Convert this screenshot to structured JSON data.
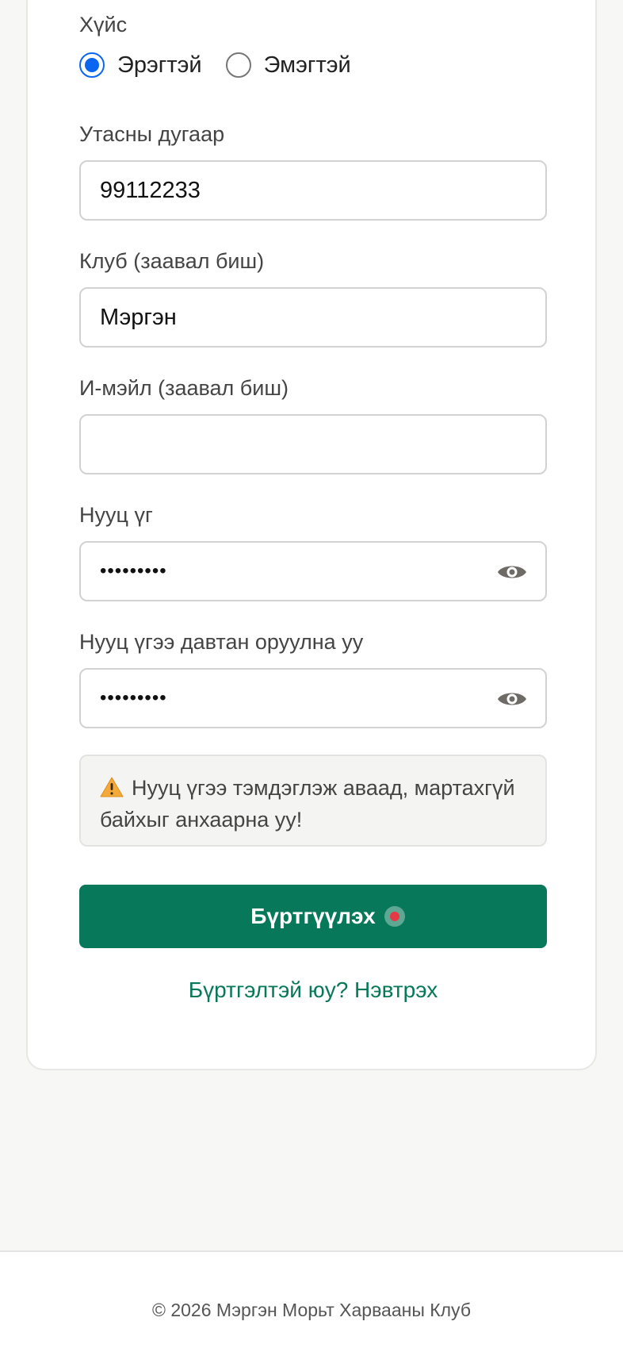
{
  "form": {
    "gender_label": "Хүйс",
    "gender_options": [
      {
        "label": "Эрэгтэй",
        "selected": true
      },
      {
        "label": "Эмэгтэй",
        "selected": false
      }
    ],
    "phone_label": "Утасны дугаар",
    "phone_value": "99112233",
    "club_label": "Клуб (заавал биш)",
    "club_value": "Мэргэн",
    "email_label": "И-мэйл (заавал биш)",
    "email_value": "",
    "password_label": "Нууц үг",
    "password_masked": "•••••••••",
    "confirm_label": "Нууц үгээ давтан оруулна уу",
    "confirm_masked": "•••••••••",
    "warning_text": "Нууц үгээ тэмдэглэж аваад, мартахгүй байхыг анхаарна уу!",
    "submit_label": "Бүртгүүлэх",
    "login_link": "Бүртгэлтэй юу? Нэвтрэх"
  },
  "footer": {
    "copyright": "© 2026 Мэргэн Морьт Харвааны Клуб"
  },
  "colors": {
    "accent": "#08785a",
    "radio_selected": "#0a66f0",
    "background": "#f7f7f5"
  },
  "icons": {
    "password_toggle": "eye-icon",
    "warning": "warning-icon"
  }
}
